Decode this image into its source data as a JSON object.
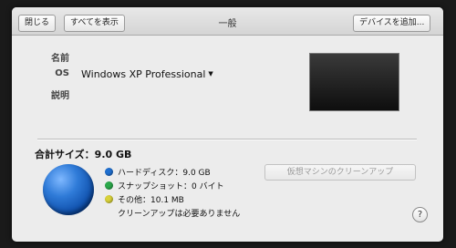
{
  "toolbar": {
    "close_label": "閉じる",
    "show_all_label": "すべてを表示",
    "title": "一般",
    "add_device_label": "デバイスを追加..."
  },
  "info": {
    "name_label": "名前",
    "os_label": "OS",
    "os_value": "Windows XP Professional",
    "description_label": "説明"
  },
  "storage": {
    "total": "合計サイズ：9.0 GB",
    "items": [
      {
        "label": "ハードディスク：9.0 GB",
        "color": "#1f6fd0"
      },
      {
        "label": "スナップショット：0 バイト",
        "color": "#2aa84a"
      },
      {
        "label": "その他：10.1 MB",
        "color": "#d9d23a"
      }
    ],
    "note": "クリーンアップは必要ありません",
    "cleanup_button": "仮想マシンのクリーンアップ"
  },
  "help": {
    "label": "?"
  }
}
